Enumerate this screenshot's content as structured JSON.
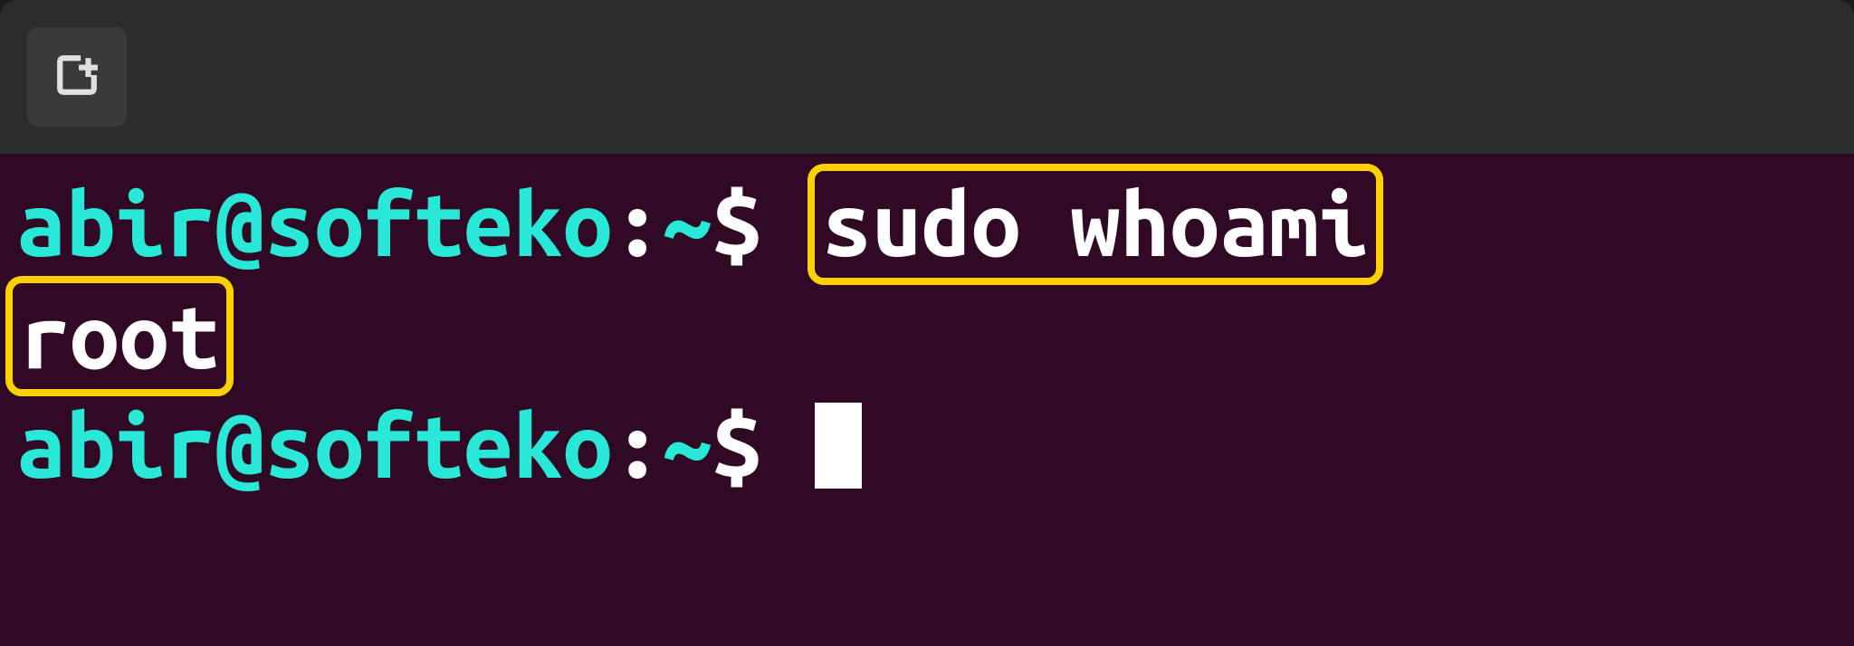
{
  "terminal": {
    "prompt": {
      "user_host": "abir@softeko",
      "separator": ":",
      "path": "~",
      "symbol": "$"
    },
    "lines": [
      {
        "command": "sudo whoami"
      },
      {
        "output": "root"
      }
    ]
  }
}
